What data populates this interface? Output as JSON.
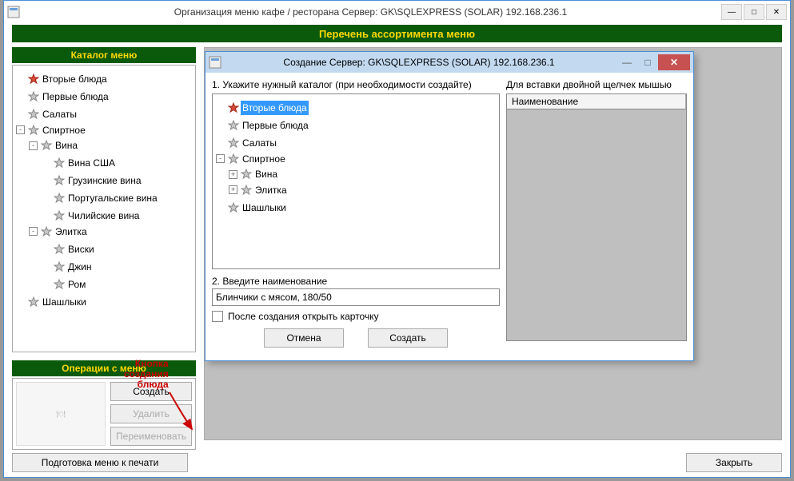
{
  "main_title": "Организация меню кафе / ресторана  Сервер: GK\\SQLEXPRESS (SOLAR) 192.168.236.1",
  "banner": "Перечень ассортимента меню",
  "left_panel": {
    "title": "Каталог меню",
    "tree": [
      {
        "label": "Вторые блюда",
        "star": "red"
      },
      {
        "label": "Первые блюда",
        "star": "grey"
      },
      {
        "label": "Салаты",
        "star": "grey"
      },
      {
        "label": "Спиртное",
        "star": "grey",
        "exp": "-",
        "children": [
          {
            "label": "Вина",
            "star": "grey",
            "exp": "-",
            "children": [
              {
                "label": "Вина США",
                "star": "grey"
              },
              {
                "label": "Грузинские вина",
                "star": "grey"
              },
              {
                "label": "Португальские вина",
                "star": "grey"
              },
              {
                "label": "Чилийские вина",
                "star": "grey"
              }
            ]
          },
          {
            "label": "Элитка",
            "star": "grey",
            "exp": "-",
            "children": [
              {
                "label": "Виски",
                "star": "grey"
              },
              {
                "label": "Джин",
                "star": "grey"
              },
              {
                "label": "Ром",
                "star": "grey"
              }
            ]
          }
        ]
      },
      {
        "label": "Шашлыки",
        "star": "grey"
      }
    ]
  },
  "callout": {
    "line1": "Кнопка",
    "line2": "создания",
    "line3": "блюда"
  },
  "ops": {
    "title": "Операции с меню",
    "create": "Создать",
    "delete": "Удалить",
    "rename": "Переименовать"
  },
  "bottom": {
    "print": "Подготовка меню к печати",
    "close": "Закрыть"
  },
  "dialog": {
    "title": "Создание  Сервер: GK\\SQLEXPRESS (SOLAR) 192.168.236.1",
    "step1": "1. Укажите нужный каталог (при необходимости создайте)",
    "right_label": "Для вставки двойной щелчек мышью",
    "grid_header": "Наименование",
    "tree": [
      {
        "label": "Вторые блюда",
        "star": "red",
        "selected": true
      },
      {
        "label": "Первые блюда",
        "star": "grey"
      },
      {
        "label": "Салаты",
        "star": "grey"
      },
      {
        "label": "Спиртное",
        "star": "grey",
        "exp": "-",
        "children": [
          {
            "label": "Вина",
            "star": "grey",
            "exp": "+"
          },
          {
            "label": "Элитка",
            "star": "grey",
            "exp": "+"
          }
        ]
      },
      {
        "label": "Шашлыки",
        "star": "grey"
      }
    ],
    "step2": "2. Введите наименование",
    "input_value": "Блинчики с мясом, 180/50",
    "checkbox_label": "После создания открыть карточку",
    "cancel": "Отмена",
    "create": "Создать"
  }
}
